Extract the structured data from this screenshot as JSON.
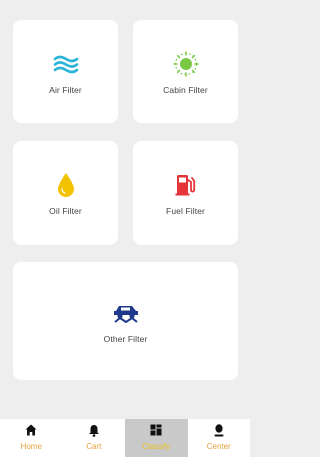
{
  "categories": [
    {
      "id": "air",
      "label": "Air Filter",
      "icon": "air-waves-icon",
      "color": "#2bb5d9"
    },
    {
      "id": "cabin",
      "label": "Cabin Filter",
      "icon": "cabin-sun-icon",
      "color": "#7ac943"
    },
    {
      "id": "oil",
      "label": "Oil Filter",
      "icon": "oil-drop-icon",
      "color": "#f2c200"
    },
    {
      "id": "fuel",
      "label": "Fuel Filter",
      "icon": "fuel-pump-icon",
      "color": "#e5343a"
    },
    {
      "id": "other",
      "label": "Other Filter",
      "icon": "car-lift-icon",
      "color": "#1f3a8a"
    }
  ],
  "tabbar": {
    "active": "Classify",
    "items": [
      {
        "label": "Home",
        "icon": "home-icon"
      },
      {
        "label": "Cart",
        "icon": "bell-icon"
      },
      {
        "label": "Classify",
        "icon": "grid-icon"
      },
      {
        "label": "Center",
        "icon": "person-icon"
      }
    ],
    "label_color": "#e6a23c",
    "active_bg": "#c9c9c9"
  }
}
